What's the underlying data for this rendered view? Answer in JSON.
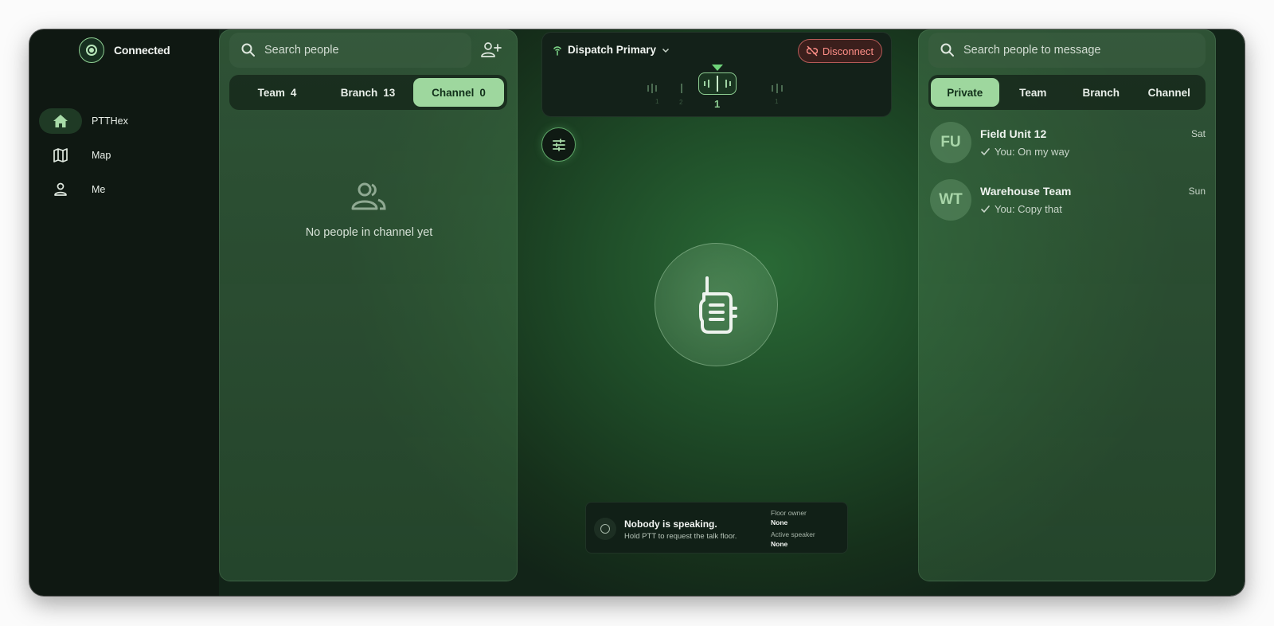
{
  "status": {
    "label": "Connected"
  },
  "nav": [
    {
      "label": "PTTHex",
      "icon": "home-icon"
    },
    {
      "label": "Map",
      "icon": "map-icon"
    },
    {
      "label": "Me",
      "icon": "person-icon"
    }
  ],
  "people": {
    "search_placeholder": "Search people",
    "tabs": [
      {
        "label": "Team",
        "count": "4"
      },
      {
        "label": "Branch",
        "count": "13"
      },
      {
        "label": "Channel",
        "count": "0"
      }
    ],
    "active_tab": "Channel",
    "empty_text": "No people in channel yet"
  },
  "channel": {
    "name": "Dispatch Primary",
    "disconnect_label": "Disconnect",
    "current_channel": "1",
    "ghost_numbers": [
      "1",
      "2",
      "1"
    ]
  },
  "talk": {
    "title": "Nobody is speaking.",
    "subtitle": "Hold PTT to request the talk floor.",
    "floor_owner_label": "Floor owner",
    "floor_owner_value": "None",
    "active_speaker_label": "Active speaker",
    "active_speaker_value": "None"
  },
  "messages": {
    "search_placeholder": "Search people to message",
    "tabs": [
      "Private",
      "Team",
      "Branch",
      "Channel"
    ],
    "active_tab": "Private",
    "conversations": [
      {
        "initials": "FU",
        "name": "Field Unit 12",
        "preview": "You: On my way",
        "time": "Sat"
      },
      {
        "initials": "WT",
        "name": "Warehouse Team",
        "preview": "You: Copy that",
        "time": "Sun"
      }
    ]
  },
  "colors": {
    "accent": "#9ed79e",
    "danger": "#ff8e87",
    "sidebar": "#0f1812"
  }
}
